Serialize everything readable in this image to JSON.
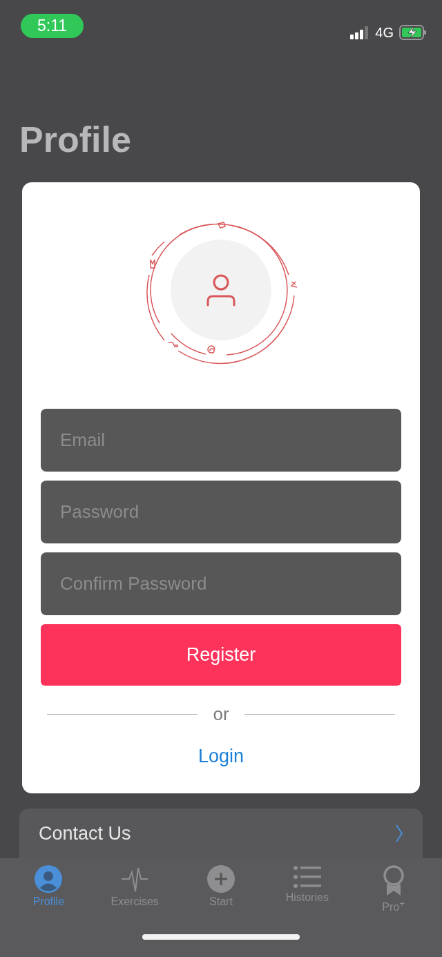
{
  "status_bar": {
    "time": "5:11",
    "network": "4G"
  },
  "title": "Profile",
  "register_form": {
    "fields": [
      {
        "placeholder": "Email"
      },
      {
        "placeholder": "Password"
      },
      {
        "placeholder": "Confirm Password"
      }
    ],
    "register_button": "Register",
    "divider_text": "or",
    "login_link": "Login"
  },
  "list_items": [
    {
      "label": "Contact Us"
    }
  ],
  "tabs": [
    {
      "label": "Profile",
      "selected": true
    },
    {
      "label": "Exercises",
      "selected": false
    },
    {
      "label": "Start",
      "selected": false
    },
    {
      "label": "Histories",
      "selected": false
    },
    {
      "label": "Pro$^{+}$",
      "selected": false
    }
  ]
}
